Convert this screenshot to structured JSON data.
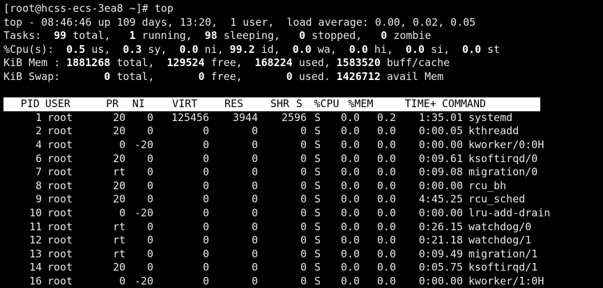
{
  "prompt": {
    "text": "[root@hcss-ecs-3ea8 ~]# top"
  },
  "summary": {
    "top_line": "top - 08:46:46 up 109 days, 13:20,  1 user,  load average: 0.00, 0.02, 0.05",
    "tasks": {
      "label": "Tasks:",
      "total": "99",
      "total_label": "total,",
      "running": "1",
      "running_label": "running,",
      "sleeping": "98",
      "sleeping_label": "sleeping,",
      "stopped": "0",
      "stopped_label": "stopped,",
      "zombie": "0",
      "zombie_label": "zombie"
    },
    "cpu": {
      "label": "%Cpu(s):",
      "us": "0.5",
      "us_label": "us,",
      "sy": "0.3",
      "sy_label": "sy,",
      "ni": "0.0",
      "ni_label": "ni,",
      "id": "99.2",
      "id_label": "id,",
      "wa": "0.0",
      "wa_label": "wa,",
      "hi": "0.0",
      "hi_label": "hi,",
      "si": "0.0",
      "si_label": "si,",
      "st": "0.0",
      "st_label": "st"
    },
    "mem": {
      "label": "KiB Mem :",
      "total": "1881268",
      "total_label": "total,",
      "free": "129524",
      "free_label": "free,",
      "used": "168224",
      "used_label": "used,",
      "buff": "1583520",
      "buff_label": "buff/cache"
    },
    "swap": {
      "label": "KiB Swap:",
      "total": "0",
      "total_label": "total,",
      "free": "0",
      "free_label": "free,",
      "used": "0",
      "used_label": "used.",
      "avail": "1426712",
      "avail_label": "avail Mem"
    }
  },
  "columns": [
    "PID",
    "USER",
    "PR",
    "NI",
    "VIRT",
    "RES",
    "SHR",
    "S",
    "%CPU",
    "%MEM",
    "TIME+",
    "COMMAND"
  ],
  "processes": [
    [
      "1",
      "root",
      "20",
      "0",
      "125456",
      "3944",
      "2596",
      "S",
      "0.0",
      "0.2",
      "1:35.01",
      "systemd"
    ],
    [
      "2",
      "root",
      "20",
      "0",
      "0",
      "0",
      "0",
      "S",
      "0.0",
      "0.0",
      "0:00.05",
      "kthreadd"
    ],
    [
      "4",
      "root",
      "0",
      "-20",
      "0",
      "0",
      "0",
      "S",
      "0.0",
      "0.0",
      "0:00.00",
      "kworker/0:0H"
    ],
    [
      "6",
      "root",
      "20",
      "0",
      "0",
      "0",
      "0",
      "S",
      "0.0",
      "0.0",
      "0:09.61",
      "ksoftirqd/0"
    ],
    [
      "7",
      "root",
      "rt",
      "0",
      "0",
      "0",
      "0",
      "S",
      "0.0",
      "0.0",
      "0:09.08",
      "migration/0"
    ],
    [
      "8",
      "root",
      "20",
      "0",
      "0",
      "0",
      "0",
      "S",
      "0.0",
      "0.0",
      "0:00.00",
      "rcu_bh"
    ],
    [
      "9",
      "root",
      "20",
      "0",
      "0",
      "0",
      "0",
      "S",
      "0.0",
      "0.0",
      "4:45.25",
      "rcu_sched"
    ],
    [
      "10",
      "root",
      "0",
      "-20",
      "0",
      "0",
      "0",
      "S",
      "0.0",
      "0.0",
      "0:00.00",
      "lru-add-drain"
    ],
    [
      "11",
      "root",
      "rt",
      "0",
      "0",
      "0",
      "0",
      "S",
      "0.0",
      "0.0",
      "0:26.15",
      "watchdog/0"
    ],
    [
      "12",
      "root",
      "rt",
      "0",
      "0",
      "0",
      "0",
      "S",
      "0.0",
      "0.0",
      "0:21.18",
      "watchdog/1"
    ],
    [
      "13",
      "root",
      "rt",
      "0",
      "0",
      "0",
      "0",
      "S",
      "0.0",
      "0.0",
      "0:09.49",
      "migration/1"
    ],
    [
      "14",
      "root",
      "20",
      "0",
      "0",
      "0",
      "0",
      "S",
      "0.0",
      "0.0",
      "0:05.75",
      "ksoftirqd/1"
    ],
    [
      "16",
      "root",
      "0",
      "-20",
      "0",
      "0",
      "0",
      "S",
      "0.0",
      "0.0",
      "0:00.00",
      "kworker/1:0H"
    ]
  ],
  "colors": {
    "background": "#000000",
    "foreground": "#e8e8e8",
    "header_bg": "#ffffff",
    "header_fg": "#000000"
  }
}
